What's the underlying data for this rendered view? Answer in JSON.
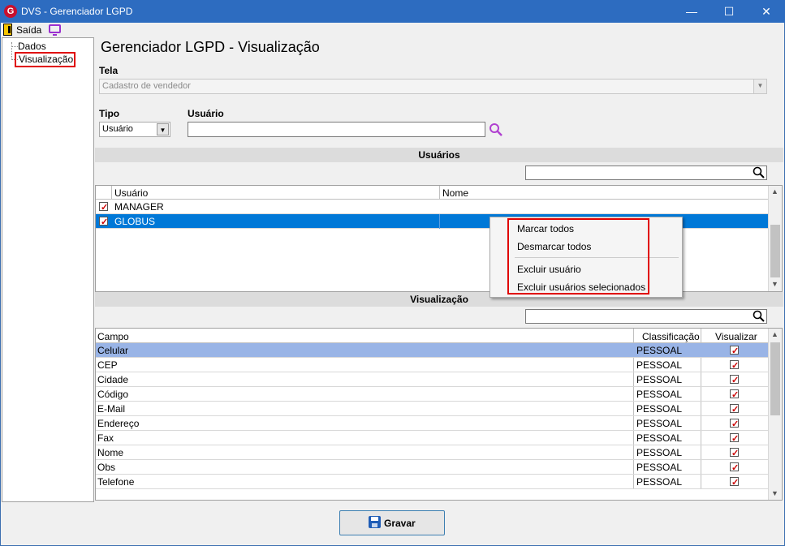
{
  "window": {
    "title": "DVS - Gerenciador LGPD",
    "min": "—",
    "max": "☐",
    "close": "✕"
  },
  "toolbar": {
    "exit_label": "Saída"
  },
  "tree": {
    "items": [
      "Dados",
      "Visualização"
    ]
  },
  "page": {
    "title": "Gerenciador LGPD - Visualização"
  },
  "tela": {
    "label": "Tela",
    "value": "Cadastro de vendedor"
  },
  "tipo": {
    "label": "Tipo",
    "value": "Usuário"
  },
  "usuario": {
    "label": "Usuário",
    "value": ""
  },
  "users_section": {
    "title": "Usuários",
    "columns": [
      "Usuário",
      "Nome"
    ],
    "rows": [
      {
        "user": "MANAGER",
        "name": "",
        "checked": true,
        "selected": false
      },
      {
        "user": "GLOBUS",
        "name": "",
        "checked": true,
        "selected": true
      }
    ]
  },
  "context_menu": {
    "items": [
      "Marcar todos",
      "Desmarcar todos",
      "Excluir usuário",
      "Excluir usuários selecionados"
    ]
  },
  "view_section": {
    "title": "Visualização",
    "columns": [
      "Campo",
      "Classificação",
      "Visualizar"
    ],
    "rows": [
      {
        "field": "Celular",
        "class": "PESSOAL",
        "checked": true
      },
      {
        "field": "CEP",
        "class": "PESSOAL",
        "checked": true
      },
      {
        "field": "Cidade",
        "class": "PESSOAL",
        "checked": true
      },
      {
        "field": "Código",
        "class": "PESSOAL",
        "checked": true
      },
      {
        "field": "E-Mail",
        "class": "PESSOAL",
        "checked": true
      },
      {
        "field": "Endereço",
        "class": "PESSOAL",
        "checked": true
      },
      {
        "field": "Fax",
        "class": "PESSOAL",
        "checked": true
      },
      {
        "field": "Nome",
        "class": "PESSOAL",
        "checked": true
      },
      {
        "field": "Obs",
        "class": "PESSOAL",
        "checked": true
      },
      {
        "field": "Telefone",
        "class": "PESSOAL",
        "checked": true
      }
    ]
  },
  "footer": {
    "save_label": "Gravar"
  },
  "colors": {
    "selection_blue": "#0078d7",
    "highlight_row": "#99b4e6",
    "annotation_red": "#e00000",
    "titlebar": "#2d6cc0"
  }
}
